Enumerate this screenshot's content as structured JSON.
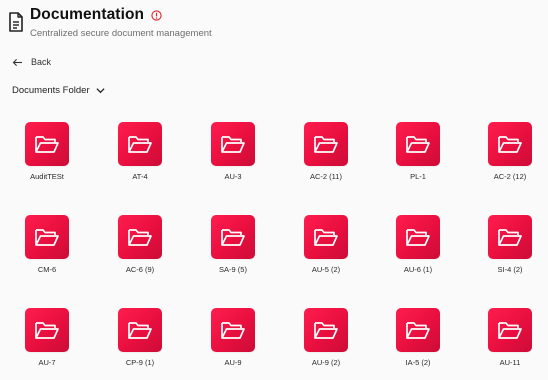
{
  "header": {
    "title": "Documentation",
    "subtitle": "Centralized secure document management"
  },
  "nav": {
    "back_label": "Back"
  },
  "folder_select": {
    "selected": "Documents Folder"
  },
  "colors": {
    "accent": "#ef1547",
    "info": "#e0242f"
  },
  "folders": [
    {
      "label": "AuditTESt"
    },
    {
      "label": "AT-4"
    },
    {
      "label": "AU-3"
    },
    {
      "label": "AC-2 (11)"
    },
    {
      "label": "PL-1"
    },
    {
      "label": "AC-2 (12)"
    },
    {
      "label": "CM-6"
    },
    {
      "label": "AC-6 (9)"
    },
    {
      "label": "SA-9 (5)"
    },
    {
      "label": "AU-5 (2)"
    },
    {
      "label": "AU-6 (1)"
    },
    {
      "label": "SI-4 (2)"
    },
    {
      "label": "AU-7"
    },
    {
      "label": "CP-9 (1)"
    },
    {
      "label": "AU-9"
    },
    {
      "label": "AU-9 (2)"
    },
    {
      "label": "IA-5 (2)"
    },
    {
      "label": "AU-11"
    }
  ]
}
